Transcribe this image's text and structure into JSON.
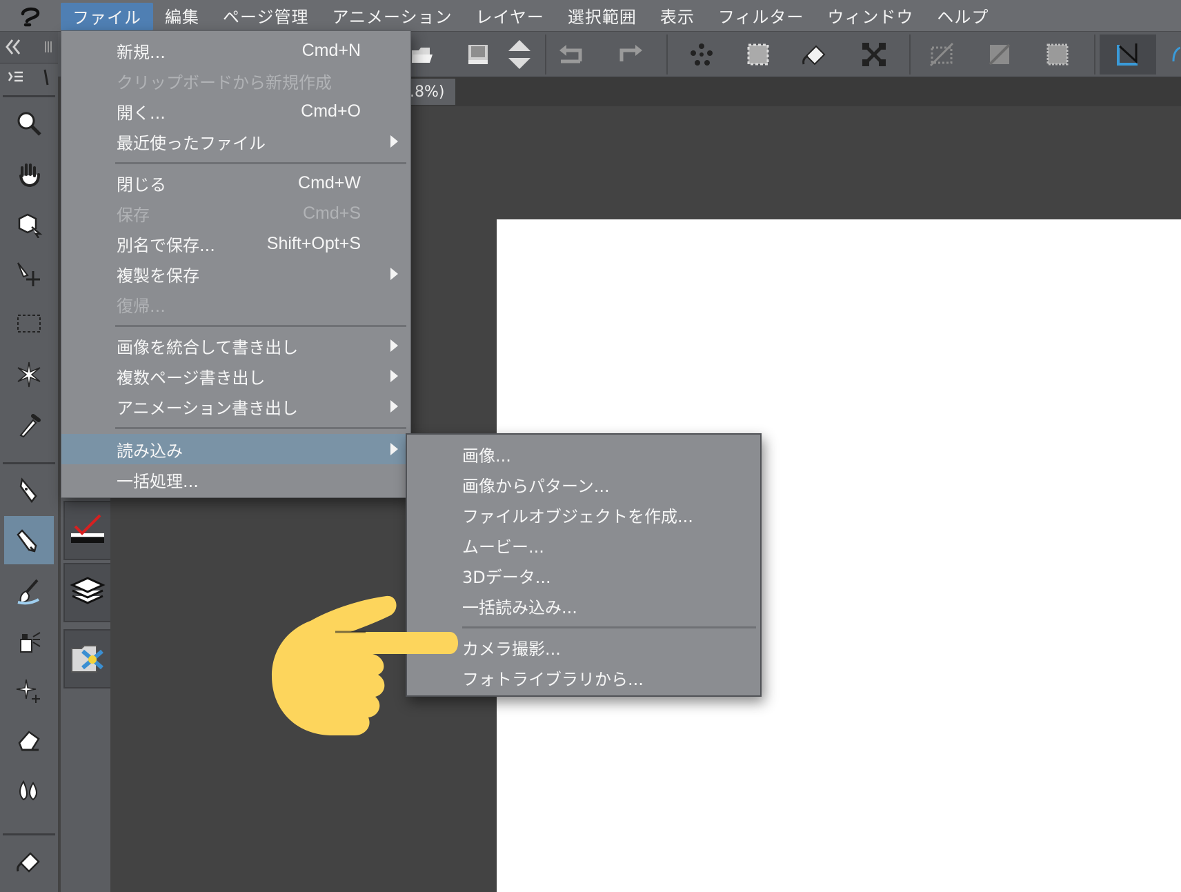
{
  "menubar": {
    "items": [
      {
        "key": "file",
        "label": "ファイル"
      },
      {
        "key": "edit",
        "label": "編集"
      },
      {
        "key": "page",
        "label": "ページ管理"
      },
      {
        "key": "animation",
        "label": "アニメーション"
      },
      {
        "key": "layer",
        "label": "レイヤー"
      },
      {
        "key": "selection",
        "label": "選択範囲"
      },
      {
        "key": "view",
        "label": "表示"
      },
      {
        "key": "filter",
        "label": "フィルター"
      },
      {
        "key": "window",
        "label": "ウィンドウ"
      },
      {
        "key": "help",
        "label": "ヘルプ"
      }
    ]
  },
  "tab": {
    "zoom_label": ".8%)"
  },
  "file_menu": {
    "items": [
      {
        "label": "新規...",
        "shortcut": "Cmd+N",
        "disabled": false
      },
      {
        "label": "クリップボードから新規作成",
        "shortcut": "",
        "disabled": true
      },
      {
        "label": "開く...",
        "shortcut": "Cmd+O",
        "disabled": false
      },
      {
        "label": "最近使ったファイル",
        "shortcut": "",
        "disabled": false,
        "submenu": true
      },
      {
        "label": "閉じる",
        "shortcut": "Cmd+W",
        "disabled": false
      },
      {
        "label": "保存",
        "shortcut": "Cmd+S",
        "disabled": true
      },
      {
        "label": "別名で保存...",
        "shortcut": "Shift+Opt+S",
        "disabled": false
      },
      {
        "label": "複製を保存",
        "shortcut": "",
        "disabled": false,
        "submenu": true
      },
      {
        "label": "復帰...",
        "shortcut": "",
        "disabled": true
      },
      {
        "label": "画像を統合して書き出し",
        "shortcut": "",
        "disabled": false,
        "submenu": true
      },
      {
        "label": "複数ページ書き出し",
        "shortcut": "",
        "disabled": false,
        "submenu": true
      },
      {
        "label": "アニメーション書き出し",
        "shortcut": "",
        "disabled": false,
        "submenu": true
      },
      {
        "label": "読み込み",
        "shortcut": "",
        "disabled": false,
        "submenu": true,
        "highlighted": true
      },
      {
        "label": "一括処理...",
        "shortcut": "",
        "disabled": false
      }
    ]
  },
  "import_submenu": {
    "items": [
      {
        "label": "画像..."
      },
      {
        "label": "画像からパターン..."
      },
      {
        "label": "ファイルオブジェクトを作成..."
      },
      {
        "label": "ムービー..."
      },
      {
        "label": "3Dデータ..."
      },
      {
        "label": "一括読み込み..."
      },
      {
        "label": "カメラ撮影..."
      },
      {
        "label": "フォトライブラリから..."
      }
    ]
  },
  "colors": {
    "menubar": "#6a6c70",
    "menu_active": "#4f7fb3",
    "dropdown": "#8b8d91",
    "highlight": "#7a93a6",
    "canvas": "#434343",
    "paper": "#ffffff",
    "pointer_hand": "#fdd55c"
  },
  "icons": {
    "app_logo": "clip-studio-logo-icon",
    "pointer": "pointing-hand-icon"
  }
}
